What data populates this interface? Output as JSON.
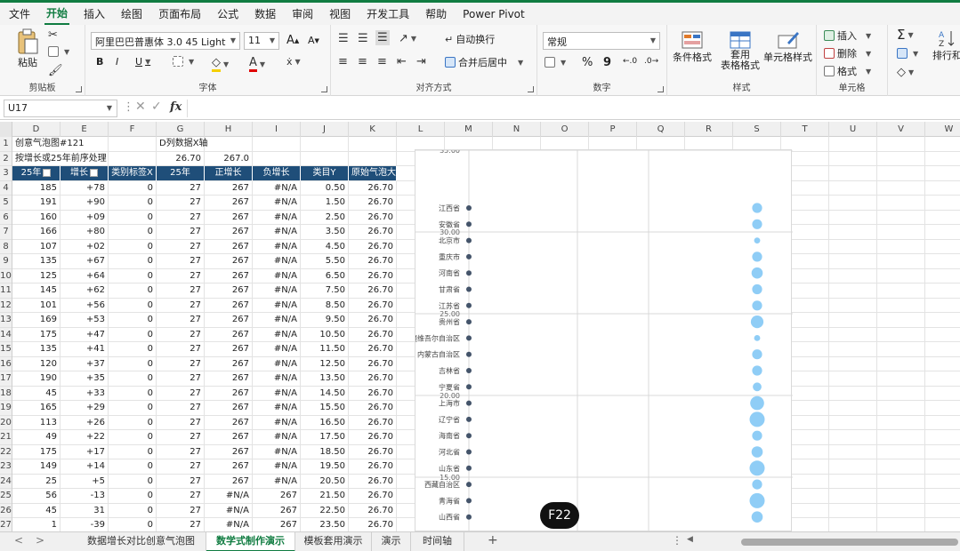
{
  "menu": [
    "文件",
    "开始",
    "插入",
    "绘图",
    "页面布局",
    "公式",
    "数据",
    "审阅",
    "视图",
    "开发工具",
    "帮助",
    "Power Pivot"
  ],
  "ribbon": {
    "clipboard": {
      "paste": "粘贴",
      "label": "剪贴板"
    },
    "font": {
      "name": "阿里巴巴普惠体 3.0 45 Light",
      "size": "11",
      "bold": "B",
      "italic": "I",
      "underline": "U",
      "grow": "A",
      "shrink": "A",
      "label": "字体"
    },
    "alignment": {
      "wrap": "自动换行",
      "merge": "合并后居中",
      "label": "对齐方式"
    },
    "number": {
      "format": "常规",
      "percent": "%",
      "comma": "9",
      "label": "数字"
    },
    "styles": {
      "conditional": "条件格式",
      "table_line1": "套用",
      "table_line2": "表格格式",
      "cell_styles": "单元格样式",
      "label": "样式"
    },
    "cells": {
      "insert": "插入",
      "delete": "删除",
      "format": "格式",
      "label": "单元格"
    },
    "editing": {
      "sigma": "Σ",
      "sort": "排行和"
    }
  },
  "formula_bar": {
    "cell_ref": "U17",
    "fx": "fx",
    "formula": ""
  },
  "columns": [
    "D",
    "E",
    "F",
    "G",
    "H",
    "I",
    "J",
    "K",
    "L",
    "M",
    "N",
    "O",
    "P",
    "Q",
    "R",
    "S",
    "T",
    "U",
    "V",
    "W"
  ],
  "rows": [
    "1",
    "2",
    "3",
    "4",
    "5",
    "6",
    "7",
    "8",
    "9",
    "10",
    "11",
    "12",
    "13",
    "14",
    "15",
    "16",
    "17",
    "18",
    "19",
    "20",
    "21",
    "22",
    "23",
    "24",
    "25",
    "26",
    "27"
  ],
  "sheet": {
    "r1_d": "创意气泡图#121",
    "r1_g": "D列数据X轴",
    "r2_d": "按增长或25年前序处理",
    "r2_g": "26.70",
    "r2_h": "267.0",
    "headers": [
      "25年",
      "增长",
      "类别标签X",
      "25年",
      "正增长",
      "负增长",
      "类目Y",
      "原始气泡大小"
    ],
    "data": [
      [
        "185",
        "+78",
        "0",
        "27",
        "267",
        "#N/A",
        "0.50",
        "26.70"
      ],
      [
        "191",
        "+90",
        "0",
        "27",
        "267",
        "#N/A",
        "1.50",
        "26.70"
      ],
      [
        "160",
        "+09",
        "0",
        "27",
        "267",
        "#N/A",
        "2.50",
        "26.70"
      ],
      [
        "166",
        "+80",
        "0",
        "27",
        "267",
        "#N/A",
        "3.50",
        "26.70"
      ],
      [
        "107",
        "+02",
        "0",
        "27",
        "267",
        "#N/A",
        "4.50",
        "26.70"
      ],
      [
        "135",
        "+67",
        "0",
        "27",
        "267",
        "#N/A",
        "5.50",
        "26.70"
      ],
      [
        "125",
        "+64",
        "0",
        "27",
        "267",
        "#N/A",
        "6.50",
        "26.70"
      ],
      [
        "145",
        "+62",
        "0",
        "27",
        "267",
        "#N/A",
        "7.50",
        "26.70"
      ],
      [
        "101",
        "+56",
        "0",
        "27",
        "267",
        "#N/A",
        "8.50",
        "26.70"
      ],
      [
        "169",
        "+53",
        "0",
        "27",
        "267",
        "#N/A",
        "9.50",
        "26.70"
      ],
      [
        "175",
        "+47",
        "0",
        "27",
        "267",
        "#N/A",
        "10.50",
        "26.70"
      ],
      [
        "135",
        "+41",
        "0",
        "27",
        "267",
        "#N/A",
        "11.50",
        "26.70"
      ],
      [
        "120",
        "+37",
        "0",
        "27",
        "267",
        "#N/A",
        "12.50",
        "26.70"
      ],
      [
        "190",
        "+35",
        "0",
        "27",
        "267",
        "#N/A",
        "13.50",
        "26.70"
      ],
      [
        "45",
        "+33",
        "0",
        "27",
        "267",
        "#N/A",
        "14.50",
        "26.70"
      ],
      [
        "165",
        "+29",
        "0",
        "27",
        "267",
        "#N/A",
        "15.50",
        "26.70"
      ],
      [
        "113",
        "+26",
        "0",
        "27",
        "267",
        "#N/A",
        "16.50",
        "26.70"
      ],
      [
        "49",
        "+22",
        "0",
        "27",
        "267",
        "#N/A",
        "17.50",
        "26.70"
      ],
      [
        "175",
        "+17",
        "0",
        "27",
        "267",
        "#N/A",
        "18.50",
        "26.70"
      ],
      [
        "149",
        "+14",
        "0",
        "27",
        "267",
        "#N/A",
        "19.50",
        "26.70"
      ],
      [
        "25",
        "+5",
        "0",
        "27",
        "267",
        "#N/A",
        "20.50",
        "26.70"
      ],
      [
        "56",
        "-13",
        "0",
        "27",
        "#N/A",
        "267",
        "21.50",
        "26.70"
      ],
      [
        "45",
        "31",
        "0",
        "27",
        "#N/A",
        "267",
        "22.50",
        "26.70"
      ],
      [
        "1",
        "-39",
        "0",
        "27",
        "#N/A",
        "267",
        "23.50",
        "26.70"
      ]
    ]
  },
  "chart_data": {
    "type": "scatter",
    "y_tick_labels": [
      "35.00",
      "30.00",
      "25.00",
      "20.00",
      "15.00"
    ],
    "categories": [
      "江西省",
      "安徽省",
      "北京市",
      "重庆市",
      "河南省",
      "甘肃省",
      "江苏省",
      "贵州省",
      "新疆维吾尔自治区",
      "内蒙古自治区",
      "吉林省",
      "宁夏省",
      "上海市",
      "辽宁省",
      "海南省",
      "河北省",
      "山东省",
      "西藏自治区",
      "青海省",
      "山西省"
    ],
    "bubble_sizes": [
      5,
      5,
      2,
      5,
      6,
      5,
      5,
      7,
      2,
      5,
      5,
      4,
      8,
      9,
      5,
      6,
      9,
      5,
      9,
      6
    ],
    "colors": {
      "bubble": "#8fcdf6",
      "axis_dot": "#44546a",
      "grid": "#d9d9d9"
    }
  },
  "badge": "F22",
  "tabs": [
    "数据增长对比创意气泡图",
    "数学式制作演示",
    "模板套用演示",
    "演示",
    "时间轴"
  ],
  "active_tab": 1
}
